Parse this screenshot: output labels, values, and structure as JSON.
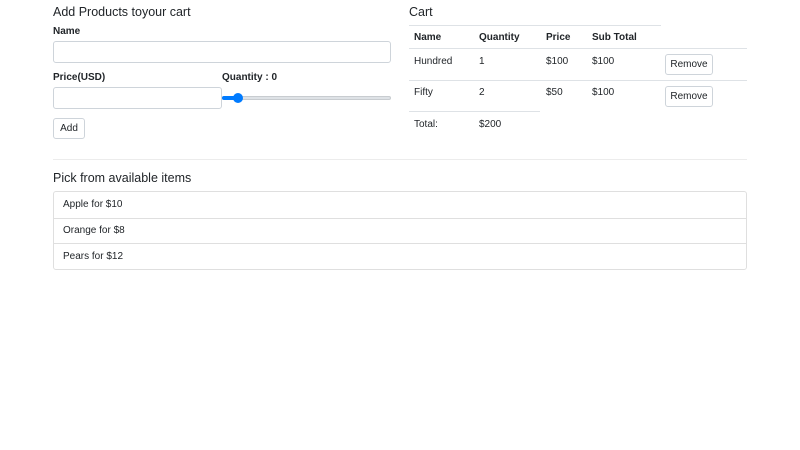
{
  "form": {
    "title": "Add Products toyour cart",
    "name_label": "Name",
    "name_value": "",
    "price_label": "Price(USD)",
    "price_value": "",
    "quantity_label": "Quantity : 0",
    "quantity_level": 0.07,
    "add_label": "Add"
  },
  "cart": {
    "title": "Cart",
    "headers": [
      "Name",
      "Quantity",
      "Price",
      "Sub Total"
    ],
    "rows": [
      {
        "name": "Hundred",
        "quantity": "1",
        "price": "$100",
        "subtotal": "$100",
        "action": "Remove"
      },
      {
        "name": "Fifty",
        "quantity": "2",
        "price": "$50",
        "subtotal": "$100",
        "action": "Remove"
      }
    ],
    "total_label": "Total:",
    "total_value": "$200"
  },
  "catalog": {
    "title": "Pick from available items",
    "items": [
      "Apple for $10",
      "Orange for $8",
      "Pears for $12"
    ]
  },
  "colors": {
    "accent": "#007bff",
    "border": "#dee2e6"
  }
}
